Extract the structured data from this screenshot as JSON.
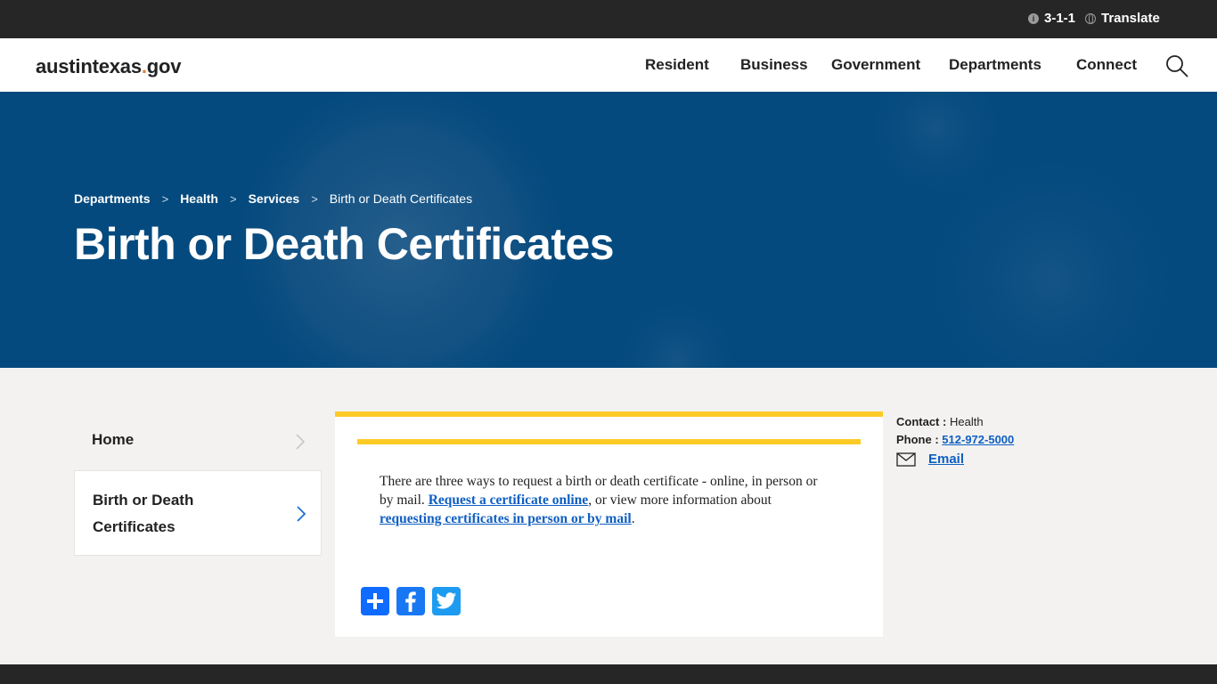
{
  "utility": {
    "info_label": "3-1-1",
    "translate_label": "Translate"
  },
  "header": {
    "logo_main": "austintexas",
    "logo_dot": ".",
    "logo_tld": "gov",
    "nav": [
      "Resident",
      "Business",
      "Government",
      "Departments",
      "Connect"
    ]
  },
  "hero": {
    "breadcrumb": [
      "Departments",
      "Health",
      "Services"
    ],
    "breadcrumb_sep": ">",
    "breadcrumb_current": "Birth or Death Certificates",
    "title": "Birth or Death Certificates"
  },
  "side_nav": {
    "items": [
      "Home",
      "Birth or Death Certificates"
    ]
  },
  "content": {
    "intro": "There are three ways to request a birth or death certificate - online, in person or by mail. ",
    "link_online": "Request a certificate online",
    "middle": ", or view more information about ",
    "link_mail": "requesting certificates in person or by mail",
    "end": "."
  },
  "share": {
    "icons": [
      "share-plus-icon",
      "facebook-icon",
      "twitter-icon"
    ]
  },
  "contact": {
    "contact_label": "Contact :",
    "contact_value": "Health",
    "phone_label": "Phone :",
    "phone_value": "512-972-5000",
    "email_label": "Email"
  },
  "colors": {
    "utility_bg": "#262626",
    "hero_bg": "#044a7e",
    "accent": "#fccb26",
    "link": "#0f5fc2",
    "logo_dot": "#e07d36",
    "page_bg": "#f3f2f0"
  }
}
